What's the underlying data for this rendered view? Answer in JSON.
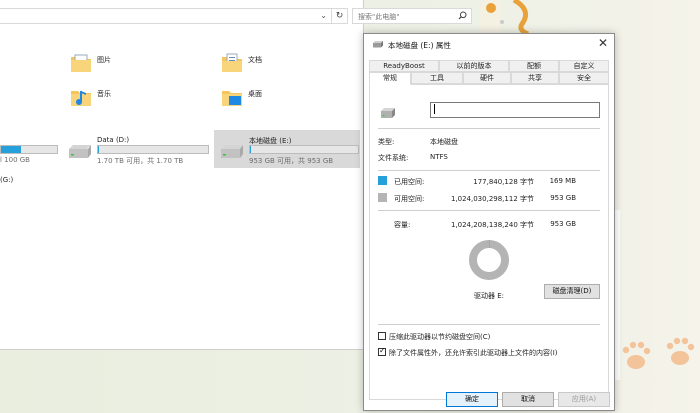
{
  "explorer": {
    "address_dropdown": "⌄",
    "refresh": "↻",
    "search_placeholder": "搜索\"此电脑\"",
    "folders": [
      {
        "label": "图片"
      },
      {
        "label": "文档"
      },
      {
        "label": "音乐"
      },
      {
        "label": "桌面"
      }
    ],
    "drives": [
      {
        "name": "",
        "size": "l 100 GB"
      },
      {
        "name": "Data (D:)",
        "size": "1.70 TB 可用，共 1.70 TB"
      },
      {
        "name": "本地磁盘 (E:)",
        "size": "953 GB 可用，共 953 GB"
      }
    ],
    "drive_g": "(G:)"
  },
  "dialog": {
    "title": "本地磁盘 (E:) 属性",
    "close": "✕",
    "tabs_row1": [
      "ReadyBoost",
      "以前的版本",
      "配额",
      "自定义"
    ],
    "tabs_row2": [
      "常规",
      "工具",
      "硬件",
      "共享",
      "安全"
    ],
    "active_tab": "常规",
    "volume_name": "",
    "type_label": "类型:",
    "type_value": "本地磁盘",
    "fs_label": "文件系统:",
    "fs_value": "NTFS",
    "used_label": "已用空间:",
    "used_bytes": "177,840,128 字节",
    "used_human": "169 MB",
    "free_label": "可用空间:",
    "free_bytes": "1,024,030,298,112 字节",
    "free_human": "953 GB",
    "capacity_label": "容量:",
    "capacity_bytes": "1,024,208,138,240 字节",
    "capacity_human": "953 GB",
    "drive_label": "驱动器 E:",
    "cleanup_button": "磁盘清理(D)",
    "compress_label": "压缩此驱动器以节约磁盘空间(C)",
    "compress_checked": false,
    "index_label": "除了文件属性外，还允许索引此驱动器上文件的内容(I)",
    "index_checked": true,
    "ok": "确定",
    "cancel": "取消",
    "apply": "应用(A)",
    "colors": {
      "used": "#26a0da",
      "free": "#b4b4b4"
    }
  }
}
